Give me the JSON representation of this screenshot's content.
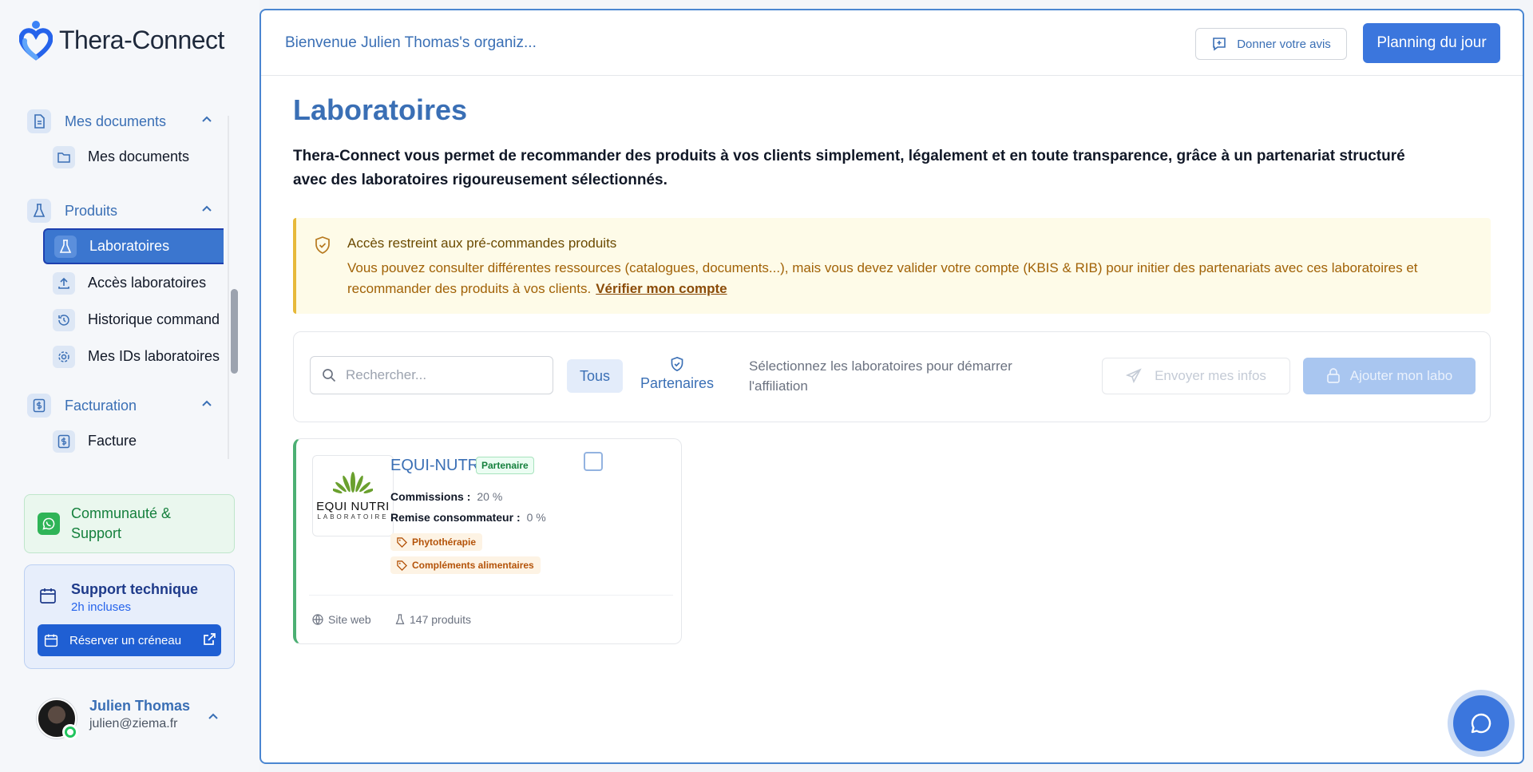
{
  "app": {
    "name": "Thera-Connect"
  },
  "sidebar": {
    "groups": [
      {
        "label": "Mes documents",
        "items": [
          {
            "label": "Mes documents"
          }
        ]
      },
      {
        "label": "Produits",
        "items": [
          {
            "label": "Laboratoires",
            "active": true
          },
          {
            "label": "Accès laboratoires"
          },
          {
            "label": "Historique command"
          },
          {
            "label": "Mes IDs laboratoires"
          }
        ]
      },
      {
        "label": "Facturation",
        "items": [
          {
            "label": "Facture"
          }
        ]
      }
    ],
    "community": {
      "label": "Communauté & Support"
    },
    "support": {
      "title": "Support technique",
      "subtitle": "2h incluses",
      "button": "Réserver un créneau"
    },
    "user": {
      "name": "Julien Thomas",
      "email": "julien@ziema.fr"
    }
  },
  "header": {
    "welcome": "Bienvenue Julien Thomas's organiz...",
    "feedback_button": "Donner votre avis",
    "planning_button": "Planning du jour"
  },
  "page": {
    "title": "Laboratoires",
    "intro": "Thera-Connect vous permet de recommander des produits à vos clients simplement, légalement et en toute transparence, grâce à un partenariat structuré avec des laboratoires rigoureusement sélectionnés."
  },
  "alert": {
    "title": "Accès restreint aux pré-commandes produits",
    "body": "Vous pouvez consulter différentes ressources (catalogues, documents...), mais vous devez valider votre compte (KBIS & RIB) pour initier des partenariats avec ces laboratoires et recommander des produits à vos clients.",
    "link": "Vérifier mon compte"
  },
  "toolbar": {
    "search_placeholder": "Rechercher...",
    "tab_all": "Tous",
    "tab_partners": "Partenaires",
    "hint": "Sélectionnez les laboratoires pour démarrer l'affiliation",
    "send_button": "Envoyer mes infos",
    "add_button": "Ajouter mon labo"
  },
  "labs": [
    {
      "name": "EQUI-NUTRI",
      "badge": "Partenaire",
      "logo_text": "EQUI NUTRI",
      "logo_subtext": "LABORATOIRE",
      "commission_label": "Commissions :",
      "commission_value": "20 %",
      "discount_label": "Remise consommateur :",
      "discount_value": "0 %",
      "tags": [
        "Phytothérapie",
        "Compléments alimentaires"
      ],
      "website_label": "Site web",
      "products_label": "147 produits"
    }
  ],
  "colors": {
    "accent": "#3b76dd",
    "brand_text": "#3a6fb5",
    "alert_bg": "#fefbe8",
    "partner_green": "#4caf73"
  }
}
